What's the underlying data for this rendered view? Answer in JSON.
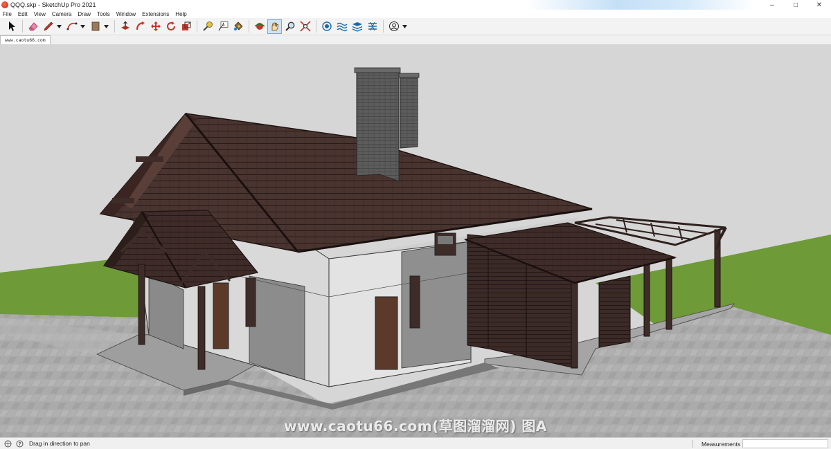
{
  "window": {
    "title": "QQQ.skp - SketchUp Pro 2021",
    "minimize_glyph": "–",
    "maximize_glyph": "□",
    "close_glyph": "✕"
  },
  "menu": {
    "items": [
      "File",
      "Edit",
      "View",
      "Camera",
      "Draw",
      "Tools",
      "Window",
      "Extensions",
      "Help"
    ]
  },
  "toolbar": {
    "tools": [
      {
        "name": "select-tool-icon",
        "active": false
      },
      {
        "name": "eraser-tool-icon",
        "active": false
      },
      {
        "name": "line-tool-icon",
        "active": false
      },
      {
        "name": "arc-tool-icon",
        "active": false
      },
      {
        "name": "shapes-tool-icon",
        "active": false
      },
      {
        "name": "push-pull-tool-icon",
        "active": false
      },
      {
        "name": "follow-me-tool-icon",
        "active": false
      },
      {
        "name": "move-tool-icon",
        "active": false
      },
      {
        "name": "rotate-tool-icon",
        "active": false
      },
      {
        "name": "scale-tool-icon",
        "active": false
      },
      {
        "name": "tape-measure-tool-icon",
        "active": false
      },
      {
        "name": "text-tool-icon",
        "active": false
      },
      {
        "name": "paint-bucket-tool-icon",
        "active": false
      },
      {
        "name": "orbit-tool-icon",
        "active": false
      },
      {
        "name": "pan-tool-icon",
        "active": true
      },
      {
        "name": "zoom-tool-icon",
        "active": false
      },
      {
        "name": "zoom-extents-tool-icon",
        "active": false
      },
      {
        "name": "warehouse-icon",
        "active": false
      },
      {
        "name": "sandbox-icon",
        "active": false
      },
      {
        "name": "layers-icon",
        "active": false
      },
      {
        "name": "extension-icon",
        "active": false
      },
      {
        "name": "account-icon",
        "active": false
      }
    ]
  },
  "scene_tab": {
    "label": "www.caotu66.com"
  },
  "viewport": {
    "watermark": "www.caotu66.com(草图溜溜网) 图A",
    "colors": {
      "sky": "#d6d6d6",
      "grass": "#6e9a38",
      "pavement": "#aaaaaa",
      "wall": "#dedede",
      "roof": "#4a3430",
      "wood": "#3f2c28",
      "chimney": "#5a5a5a"
    }
  },
  "status": {
    "hint": "Drag in direction to pan",
    "measurements_label": "Measurements",
    "measurements_value": ""
  }
}
